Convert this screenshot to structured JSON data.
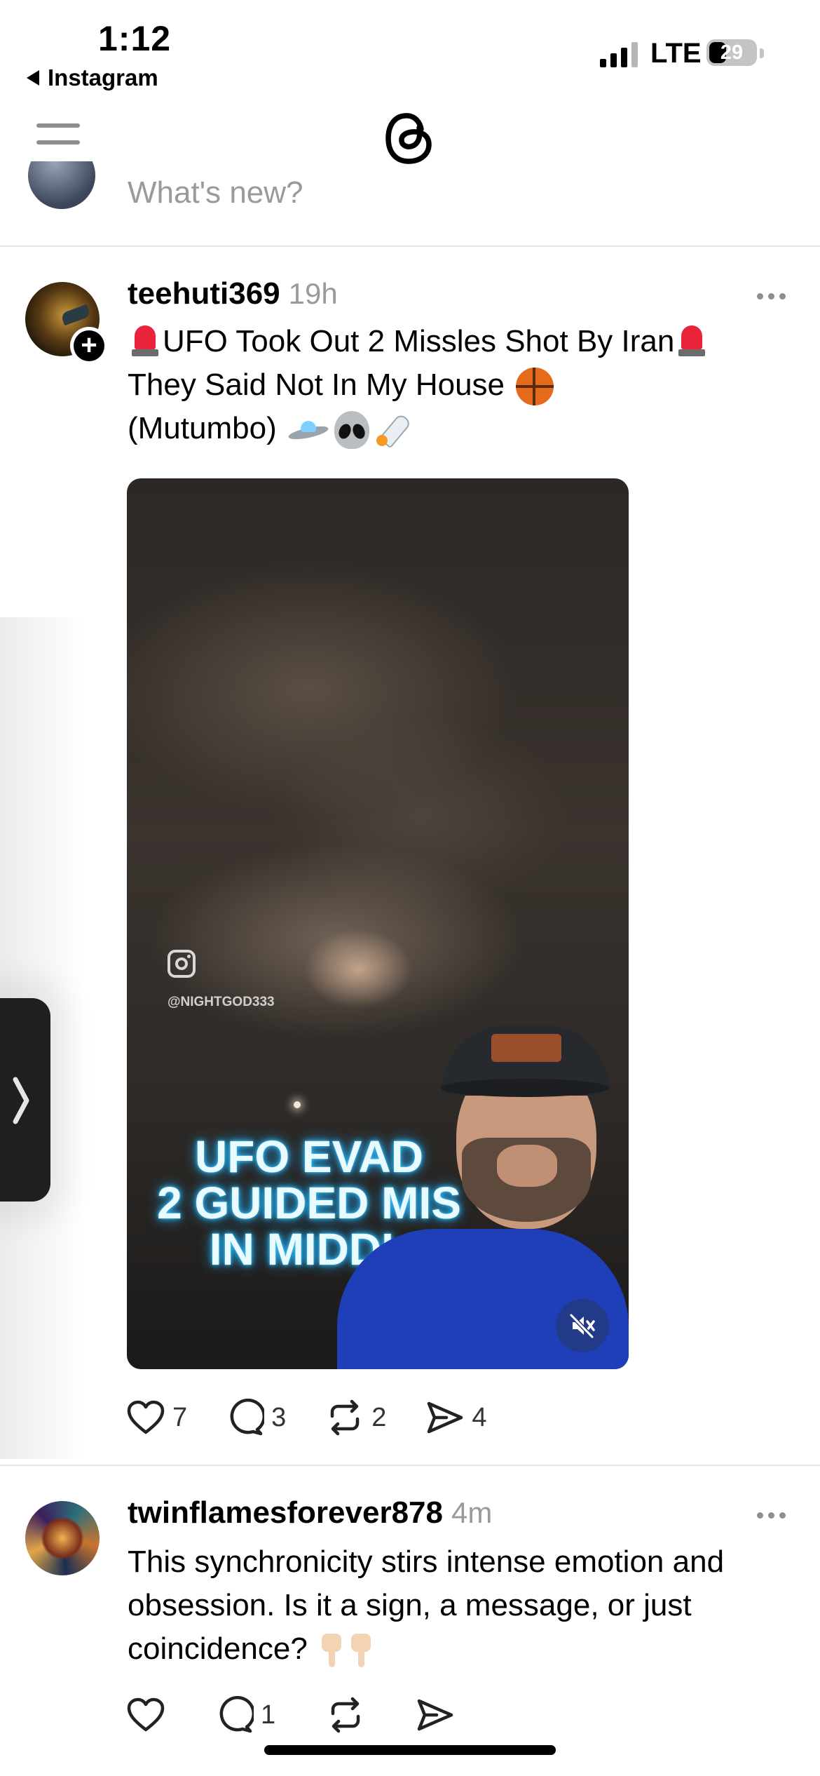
{
  "status_bar": {
    "time": "1:12",
    "back_app": "Instagram",
    "network": "LTE",
    "battery_level": "29"
  },
  "nav": {
    "menu_icon": "hamburger-icon",
    "logo_icon": "threads-logo-icon"
  },
  "composer": {
    "placeholder": "What's new?"
  },
  "posts": [
    {
      "username": "teehuti369",
      "time": "19h",
      "line1": "UFO Took Out 2 Missles Shot By Iran",
      "line2": "They Said Not In My House",
      "line3": "(Mutumbo)",
      "video": {
        "watermark_handle": "@NIGHTGOD333",
        "overlay_text": "UFO EVAD\n2 GUIDED MIS\nIN MIDDL"
      },
      "likes": "7",
      "comments": "3",
      "reposts": "2",
      "shares": "4"
    },
    {
      "username": "twinflamesforever878",
      "time": "4m",
      "line1": "This synchronicity stirs intense emotion and",
      "line2": "obsession. Is it a sign, a message, or just",
      "line3": "coincidence?",
      "comments": "1"
    }
  ],
  "colors": {
    "muted_text": "#9a9a9a",
    "video_overlay_glow": "#37c9ff",
    "mute_button": "#223a88"
  }
}
